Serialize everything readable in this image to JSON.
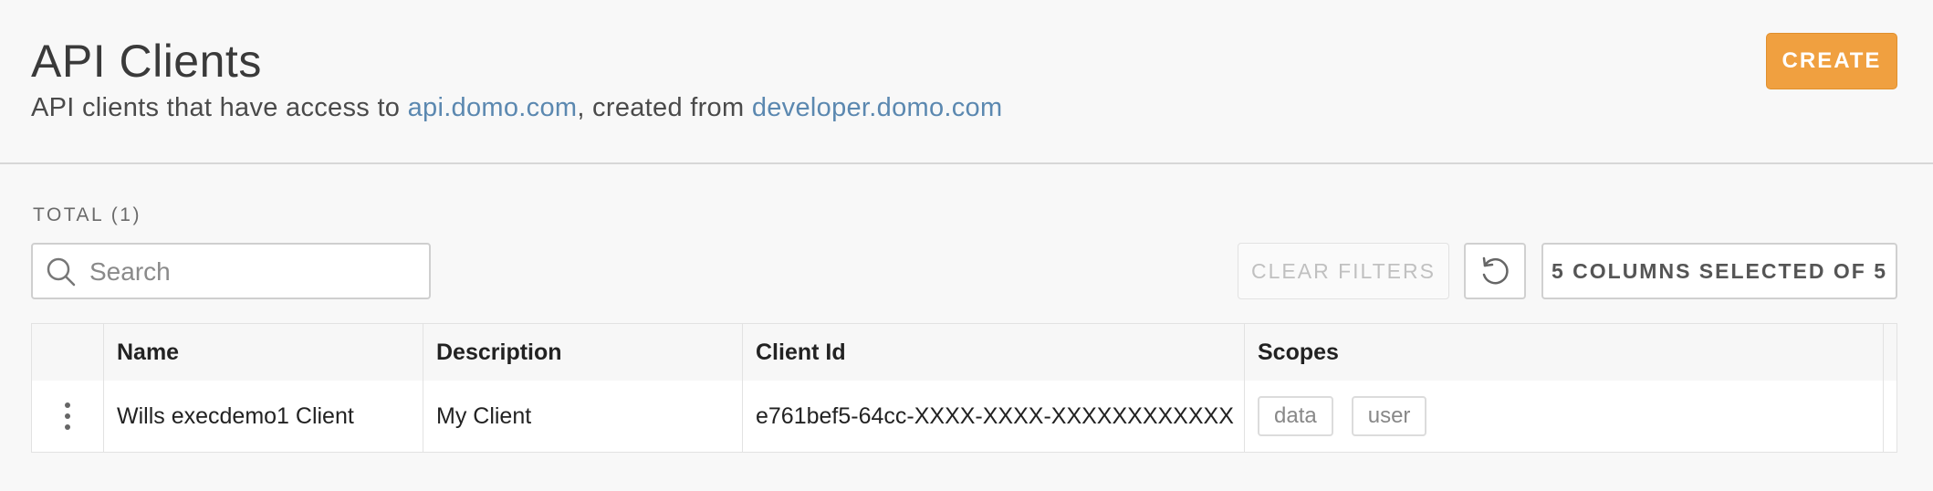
{
  "header": {
    "title": "API Clients",
    "subtitle_prefix": "API clients that have access to ",
    "subtitle_link1": "api.domo.com",
    "subtitle_middle": ", created from ",
    "subtitle_link2": "developer.domo.com",
    "create_label": "CREATE"
  },
  "toolbar": {
    "total_label": "TOTAL (1)",
    "search_placeholder": "Search",
    "clear_filters_label": "CLEAR FILTERS",
    "columns_label": "5 COLUMNS SELECTED OF 5"
  },
  "table": {
    "columns": [
      "Name",
      "Description",
      "Client Id",
      "Scopes"
    ],
    "rows": [
      {
        "name": "Wills execdemo1 Client",
        "description": "My Client",
        "client_id": "e761bef5-64cc-XXXX-XXXX-XXXXXXXXXXXX",
        "scopes": [
          "data",
          "user"
        ]
      }
    ]
  },
  "colors": {
    "accent": "#f0a040",
    "link": "#5b88b0"
  },
  "icons": {
    "search": "search-icon",
    "reset": "reset-icon",
    "row_menu": "kebab-menu-icon"
  }
}
